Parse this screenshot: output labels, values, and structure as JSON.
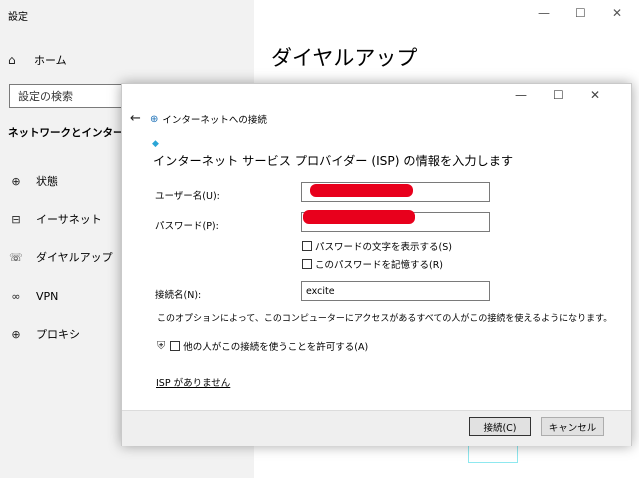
{
  "settings": {
    "title": "設定",
    "home_label": "ホーム",
    "search_placeholder": "設定の検索",
    "section_title": "ネットワークとインターネット",
    "nav_items": [
      {
        "label": "状態",
        "icon": "globe-icon"
      },
      {
        "label": "イーサネット",
        "icon": "ethernet-icon"
      },
      {
        "label": "ダイヤルアップ",
        "icon": "dialup-icon"
      },
      {
        "label": "VPN",
        "icon": "vpn-icon"
      },
      {
        "label": "プロキシ",
        "icon": "globe-icon"
      }
    ],
    "page_title": "ダイヤルアップ",
    "window_controls": {
      "minimize": "—",
      "maximize": "☐",
      "close": "✕"
    }
  },
  "dialog": {
    "caption": "インターネットへの接続",
    "heading": "インターネット サービス プロバイダー (ISP) の情報を入力します",
    "username_label": "ユーザー名(U):",
    "username_value": "",
    "password_label": "パスワード(P):",
    "password_value": "",
    "show_password_label": "パスワードの文字を表示する(S)",
    "remember_password_label": "このパスワードを記憶する(R)",
    "connection_name_label": "接続名(N):",
    "connection_name_value": "excite",
    "note": "このオプションによって、このコンピューターにアクセスがあるすべての人がこの接続を使えるようになります。",
    "allow_others_label": "他の人がこの接続を使うことを許可する(A)",
    "no_isp_link": "ISP がありません",
    "connect_button": "接続(C)",
    "cancel_button": "キャンセル",
    "window_controls": {
      "minimize": "—",
      "maximize": "☐",
      "close": "✕"
    }
  },
  "colors": {
    "redaction": "#e8001c",
    "sidebar_bg": "#f2f2f2"
  }
}
